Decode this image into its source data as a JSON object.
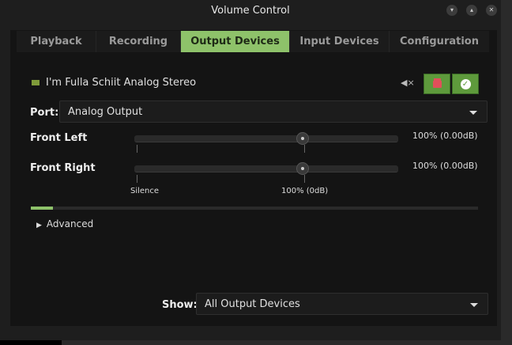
{
  "window": {
    "title": "Volume Control",
    "buttons": [
      "minimize",
      "maximize",
      "close"
    ]
  },
  "tabs": [
    {
      "label": "Playback"
    },
    {
      "label": "Recording"
    },
    {
      "label": "Output Devices",
      "active": true
    },
    {
      "label": "Input Devices"
    },
    {
      "label": "Configuration"
    }
  ],
  "device": {
    "name": "I'm Fulla Schiit Analog Stereo",
    "muted_icon": "speaker-muted-icon",
    "lock_icon": "lock-icon",
    "default_icon": "check-icon"
  },
  "port": {
    "label": "Port:",
    "value": "Analog Output"
  },
  "channels": [
    {
      "name": "Front Left",
      "value_text": "100% (0.00dB)",
      "percent": 100
    },
    {
      "name": "Front Right",
      "value_text": "100% (0.00dB)",
      "percent": 100
    }
  ],
  "scale": {
    "silence": "Silence",
    "normal": "100% (0dB)",
    "max_percent": 153
  },
  "meter": {
    "level_percent": 5
  },
  "advanced": {
    "label": "Advanced"
  },
  "show": {
    "label": "Show:",
    "value": "All Output Devices"
  },
  "colors": {
    "accent": "#8ec26a",
    "lock": "#e0505a"
  }
}
